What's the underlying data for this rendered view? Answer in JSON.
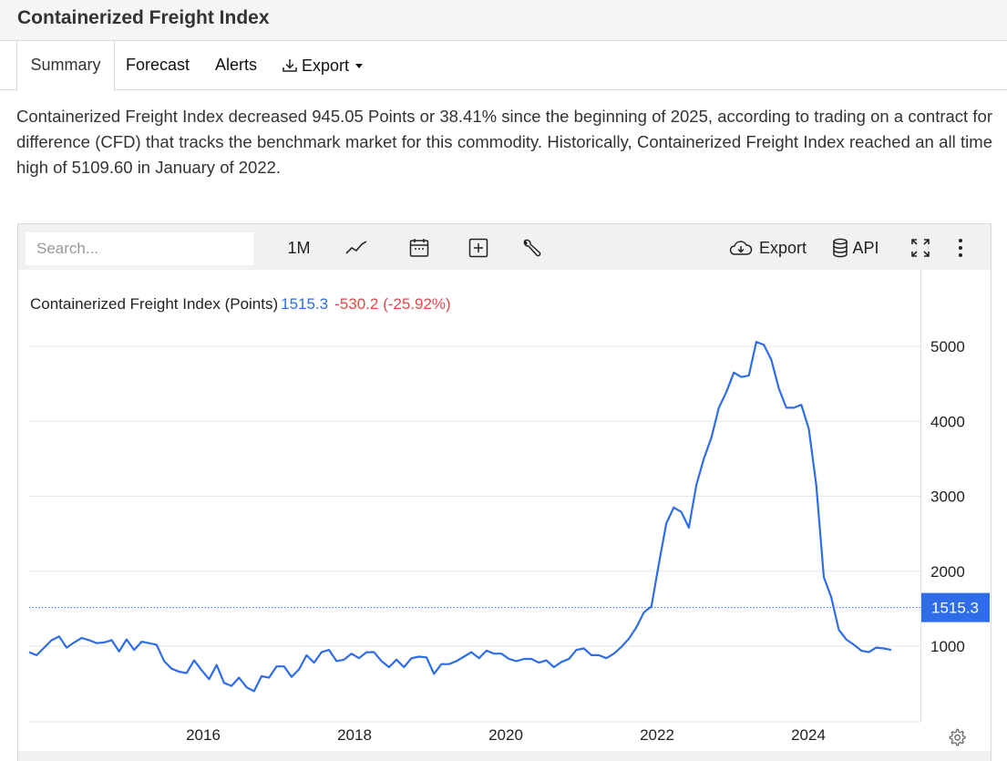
{
  "page": {
    "title": "Containerized Freight Index"
  },
  "tabs": [
    {
      "label": "Summary",
      "active": true
    },
    {
      "label": "Forecast"
    },
    {
      "label": "Alerts"
    },
    {
      "label": "Export"
    }
  ],
  "description": "Containerized Freight Index decreased 945.05 Points or 38.41% since the beginning of 2025, according to trading on a contract for difference (CFD) that tracks the benchmark market for this commodity. Historically, Containerized Freight Index reached an all time high of 5109.60 in January of 2022.",
  "toolbar": {
    "search_placeholder": "Search...",
    "period_label": "1M",
    "export_label": "Export",
    "api_label": "API",
    "icons": [
      "line-chart-icon",
      "calendar-icon",
      "add-compare-icon",
      "wrench-icon",
      "cloud-download-icon",
      "database-icon",
      "fullscreen-icon",
      "more-vert-icon"
    ]
  },
  "legend": {
    "name": "Containerized Freight Index (Points)",
    "value": "1515.3",
    "change": "-530.2 (-25.92%)"
  },
  "colors": {
    "line": "#2f6de8",
    "change_negative": "#e04848",
    "last_value_tag": "#2f6de8"
  },
  "chart_data": {
    "type": "line",
    "title": "Containerized Freight Index (Points)",
    "xlabel": "",
    "ylabel": "",
    "x_ticks": [
      "2016",
      "2018",
      "2020",
      "2022",
      "2024"
    ],
    "y_ticks": [
      1000,
      2000,
      3000,
      4000,
      5000
    ],
    "ylim": [
      0,
      5600
    ],
    "xlim": [
      2014.0,
      2025.5
    ],
    "grid": true,
    "y_axis_position": "right",
    "last_value_label": "1515.3",
    "series": [
      {
        "name": "Containerized Freight Index",
        "points": [
          [
            2014.0,
            920
          ],
          [
            2014.1,
            880
          ],
          [
            2014.2,
            980
          ],
          [
            2014.3,
            1080
          ],
          [
            2014.4,
            1130
          ],
          [
            2014.5,
            980
          ],
          [
            2014.6,
            1050
          ],
          [
            2014.7,
            1110
          ],
          [
            2014.8,
            1080
          ],
          [
            2014.9,
            1040
          ],
          [
            2015.0,
            1050
          ],
          [
            2015.1,
            1080
          ],
          [
            2015.2,
            930
          ],
          [
            2015.3,
            1090
          ],
          [
            2015.4,
            950
          ],
          [
            2015.5,
            1060
          ],
          [
            2015.6,
            1040
          ],
          [
            2015.7,
            1020
          ],
          [
            2015.8,
            800
          ],
          [
            2015.9,
            700
          ],
          [
            2016.0,
            660
          ],
          [
            2016.1,
            640
          ],
          [
            2016.2,
            810
          ],
          [
            2016.3,
            680
          ],
          [
            2016.4,
            560
          ],
          [
            2016.5,
            750
          ],
          [
            2016.6,
            510
          ],
          [
            2016.7,
            470
          ],
          [
            2016.8,
            580
          ],
          [
            2016.9,
            450
          ],
          [
            2017.0,
            400
          ],
          [
            2017.1,
            600
          ],
          [
            2017.2,
            580
          ],
          [
            2017.3,
            730
          ],
          [
            2017.4,
            730
          ],
          [
            2017.5,
            590
          ],
          [
            2017.6,
            690
          ],
          [
            2017.7,
            880
          ],
          [
            2017.8,
            780
          ],
          [
            2017.9,
            920
          ],
          [
            2018.0,
            950
          ],
          [
            2018.1,
            800
          ],
          [
            2018.2,
            820
          ],
          [
            2018.3,
            900
          ],
          [
            2018.4,
            840
          ],
          [
            2018.5,
            920
          ],
          [
            2018.6,
            920
          ],
          [
            2018.7,
            800
          ],
          [
            2018.8,
            720
          ],
          [
            2018.9,
            820
          ],
          [
            2019.0,
            720
          ],
          [
            2019.1,
            840
          ],
          [
            2019.2,
            860
          ],
          [
            2019.3,
            850
          ],
          [
            2019.4,
            630
          ],
          [
            2019.5,
            760
          ],
          [
            2019.6,
            760
          ],
          [
            2019.7,
            800
          ],
          [
            2019.8,
            860
          ],
          [
            2019.9,
            920
          ],
          [
            2020.0,
            840
          ],
          [
            2020.1,
            940
          ],
          [
            2020.2,
            900
          ],
          [
            2020.3,
            900
          ],
          [
            2020.4,
            830
          ],
          [
            2020.5,
            800
          ],
          [
            2020.6,
            830
          ],
          [
            2020.7,
            830
          ],
          [
            2020.8,
            780
          ],
          [
            2020.9,
            810
          ],
          [
            2021.0,
            720
          ],
          [
            2021.1,
            790
          ],
          [
            2021.2,
            830
          ],
          [
            2021.3,
            950
          ],
          [
            2021.4,
            970
          ],
          [
            2021.5,
            880
          ],
          [
            2021.6,
            880
          ],
          [
            2021.7,
            840
          ],
          [
            2021.8,
            900
          ],
          [
            2021.9,
            990
          ],
          [
            2022.0,
            1100
          ],
          [
            2022.1,
            1250
          ],
          [
            2022.2,
            1450
          ],
          [
            2022.3,
            1530
          ],
          [
            2022.4,
            2100
          ],
          [
            2022.5,
            2640
          ],
          [
            2022.6,
            2850
          ],
          [
            2022.7,
            2790
          ],
          [
            2022.8,
            2580
          ],
          [
            2022.9,
            3150
          ],
          [
            2023.0,
            3500
          ],
          [
            2023.1,
            3780
          ],
          [
            2023.2,
            4180
          ],
          [
            2023.3,
            4390
          ],
          [
            2023.4,
            4650
          ],
          [
            2023.5,
            4590
          ],
          [
            2023.6,
            4610
          ],
          [
            2023.7,
            5060
          ],
          [
            2023.8,
            5020
          ],
          [
            2023.9,
            4820
          ],
          [
            2024.0,
            4440
          ],
          [
            2024.1,
            4180
          ],
          [
            2024.2,
            4180
          ],
          [
            2024.3,
            4220
          ],
          [
            2024.4,
            3900
          ],
          [
            2024.5,
            3150
          ],
          [
            2024.6,
            1920
          ],
          [
            2024.7,
            1650
          ],
          [
            2024.8,
            1220
          ],
          [
            2024.9,
            1090
          ],
          [
            2025.0,
            1020
          ],
          [
            2025.1,
            940
          ],
          [
            2025.2,
            920
          ],
          [
            2025.3,
            980
          ],
          [
            2025.4,
            970
          ],
          [
            2025.5,
            950
          ]
        ]
      }
    ]
  }
}
